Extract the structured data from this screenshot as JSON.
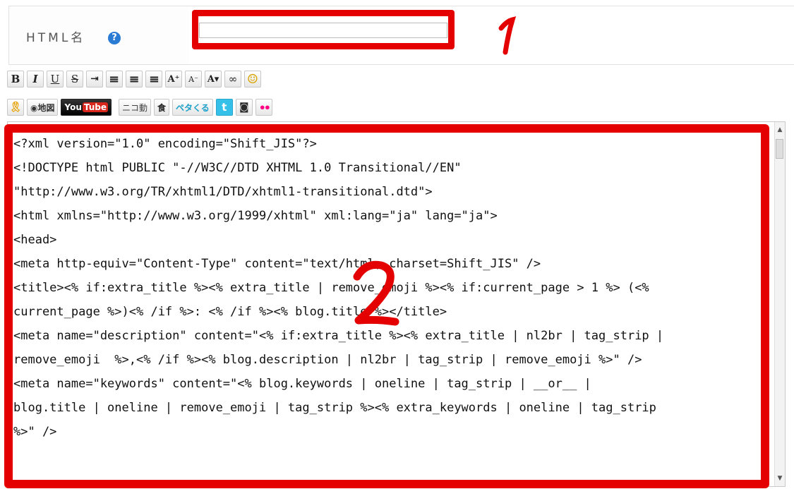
{
  "form": {
    "label": "HTML名",
    "help_icon": "question-circle-icon",
    "help_glyph": "?",
    "name_value": ""
  },
  "toolbar_row1": [
    {
      "name": "bold-button",
      "glyph": "B"
    },
    {
      "name": "italic-button",
      "glyph": "I"
    },
    {
      "name": "underline-button",
      "glyph": "U"
    },
    {
      "name": "strikethrough-button",
      "glyph": "S"
    },
    {
      "name": "indent-button",
      "glyph": "⇥"
    },
    {
      "name": "align-left-button",
      "glyph": "≡"
    },
    {
      "name": "align-center-button",
      "glyph": "≡"
    },
    {
      "name": "align-right-button",
      "glyph": "≡"
    },
    {
      "name": "font-larger-button",
      "glyph": "A⁺"
    },
    {
      "name": "font-smaller-button",
      "glyph": "A⁻"
    },
    {
      "name": "font-color-button",
      "glyph": "A▾"
    },
    {
      "name": "link-button",
      "glyph": "∞"
    },
    {
      "name": "emoji-button",
      "glyph": "☺"
    }
  ],
  "toolbar_row2": [
    {
      "name": "ribbon-button",
      "glyph": "🎗"
    },
    {
      "name": "map-button",
      "glyph": "◉地図"
    },
    {
      "name": "youtube-button",
      "glyph": "YouTube"
    },
    {
      "name": "niconico-button",
      "glyph": "ニコ動"
    },
    {
      "name": "food-button",
      "glyph": "食"
    },
    {
      "name": "petakuru-button",
      "glyph": "ペタくる"
    },
    {
      "name": "tumblr-button",
      "glyph": "t"
    },
    {
      "name": "instagram-button",
      "glyph": "◙"
    },
    {
      "name": "flickr-button",
      "glyph": "••"
    }
  ],
  "annotations": {
    "mark_1": "1",
    "mark_2": "2",
    "color": "#e40000"
  },
  "editor": {
    "code": "<?xml version=\"1.0\" encoding=\"Shift_JIS\"?>\n<!DOCTYPE html PUBLIC \"-//W3C//DTD XHTML 1.0 Transitional//EN\"\n\"http://www.w3.org/TR/xhtml1/DTD/xhtml1-transitional.dtd\">\n<html xmlns=\"http://www.w3.org/1999/xhtml\" xml:lang=\"ja\" lang=\"ja\">\n<head>\n<meta http-equiv=\"Content-Type\" content=\"text/html; charset=Shift_JIS\" />\n<title><% if:extra_title %><% extra_title | remove_emoji %><% if:current_page > 1 %> (<%\ncurrent_page %>)<% /if %>: <% /if %><% blog.title %></title>\n<meta name=\"description\" content=\"<% if:extra_title %><% extra_title | nl2br | tag_strip |\nremove_emoji  %>,<% /if %><% blog.description | nl2br | tag_strip | remove_emoji %>\" />\n<meta name=\"keywords\" content=\"<% blog.keywords | oneline | tag_strip | __or__ |\nblog.title | oneline | remove_emoji | tag_strip %><% extra_keywords | oneline | tag_strip\n%>\" />"
  }
}
